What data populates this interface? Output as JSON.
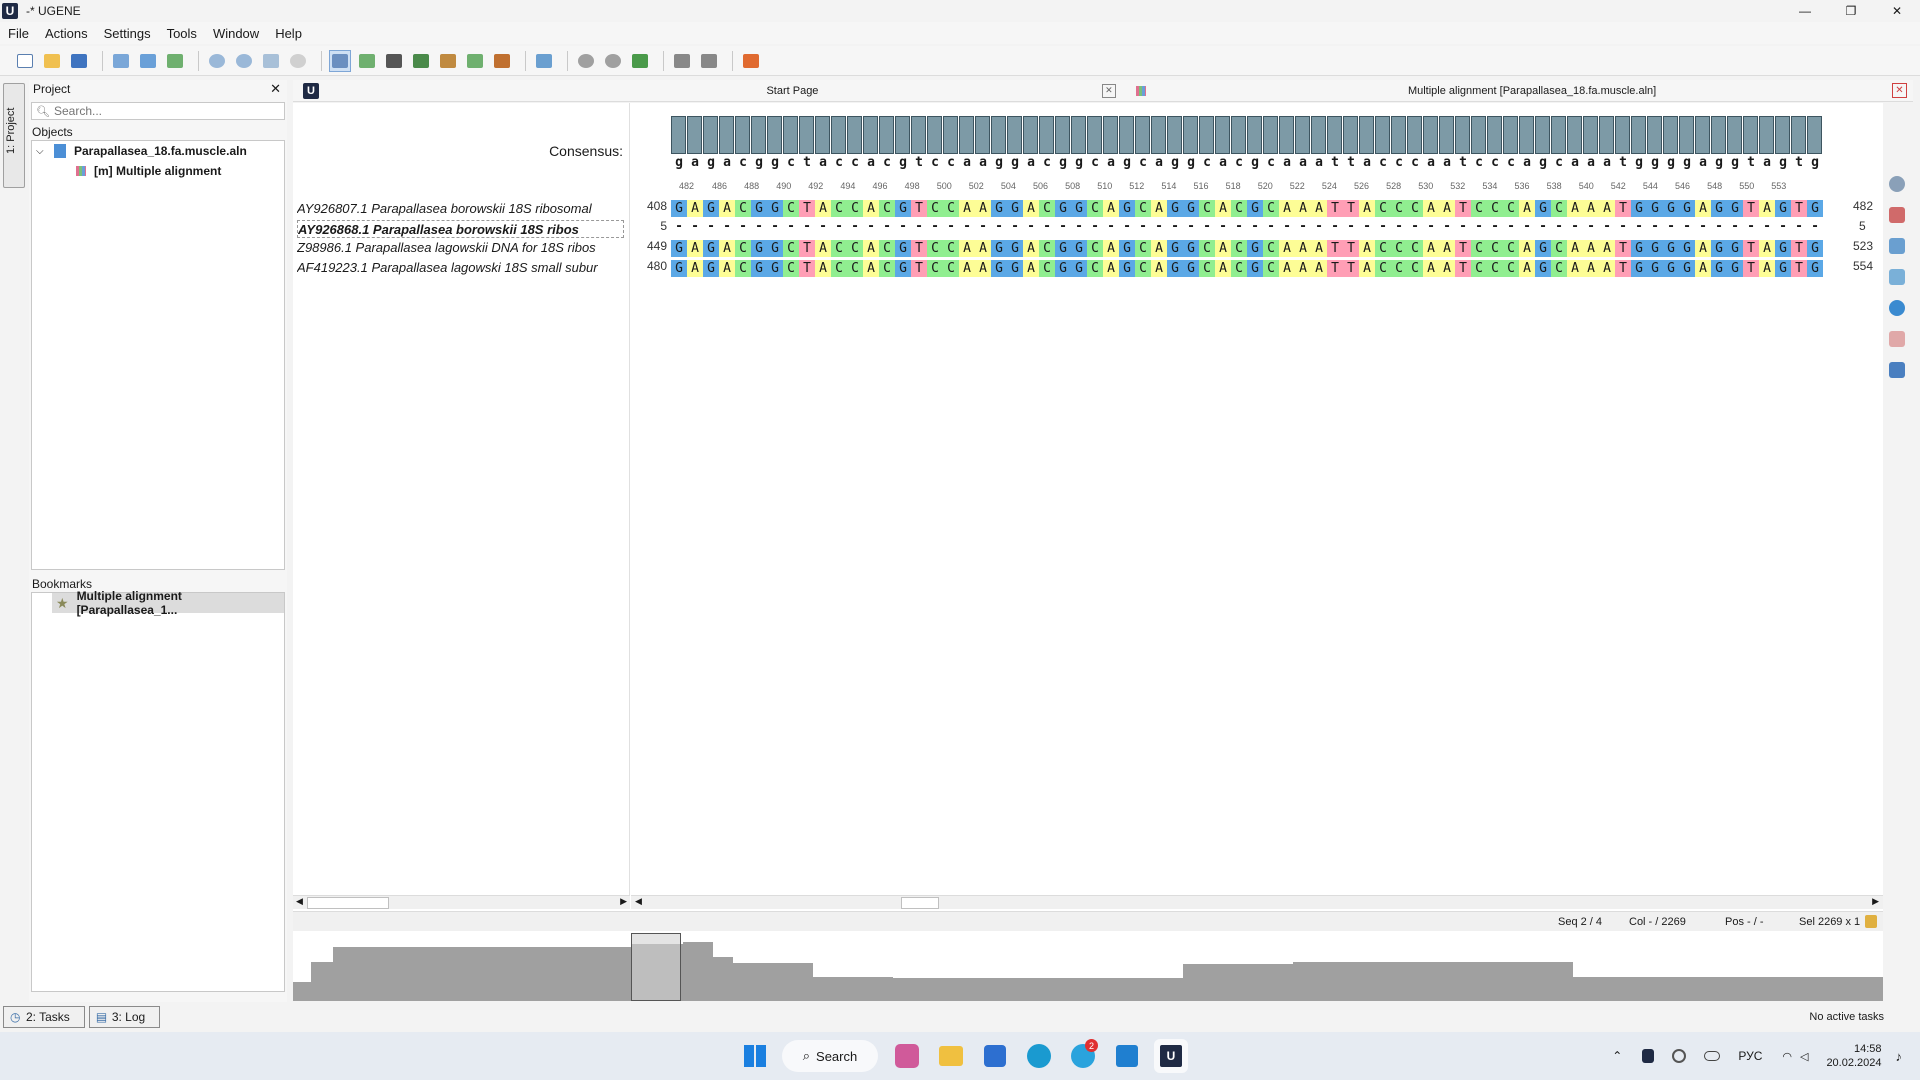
{
  "window": {
    "title": "-* UGENE",
    "app_icon_letter": "U"
  },
  "menu": [
    "File",
    "Actions",
    "Settings",
    "Tools",
    "Window",
    "Help"
  ],
  "side_tab_label": "1: Project",
  "project": {
    "header": "Project",
    "search_placeholder": "Search...",
    "objects_label": "Objects",
    "file_item": "Parapallasea_18.fa.muscle.aln",
    "alignment_item": "[m] Multiple alignment",
    "bookmarks_label": "Bookmarks",
    "bookmark_item": "Multiple alignment [Parapallasea_1..."
  },
  "bottom_tabs": [
    "2: Tasks",
    "3: Log"
  ],
  "no_tasks": "No active tasks",
  "tabs": {
    "start_page": "Start Page",
    "alignment_tab": "Multiple alignment [Parapallasea_18.fa.muscle.aln]",
    "editor_logo": "U"
  },
  "editor": {
    "consensus_label": "Consensus:",
    "consensus_seq": "gagacggctaccacgtccaaggacggcagcaggcacgcaaattacccaatcccagcaaatggggaggtagtg",
    "ruler": [
      "482",
      "486",
      "488",
      "490",
      "492",
      "494",
      "496",
      "498",
      "500",
      "502",
      "504",
      "506",
      "508",
      "510",
      "512",
      "514",
      "516",
      "518",
      "520",
      "522",
      "524",
      "526",
      "528",
      "530",
      "532",
      "534",
      "536",
      "538",
      "540",
      "542",
      "544",
      "546",
      "548",
      "550",
      "553"
    ],
    "sequences": [
      {
        "name": "AY926807.1 Parapallasea borowskii 18S ribosomal",
        "left": "408",
        "right": "482",
        "seq": "GAGACGGCTACCACGTCCAAGGACGGCAGCAGGCACGCAAATTACCCAATCCCAGCAAATGGGGAGGTAGTG"
      },
      {
        "name": "AY926868.1 Parapallasea borowskii 18S ribos",
        "left": "5",
        "right": "5",
        "seq": "------------------------------------------------------------------------"
      },
      {
        "name": "Z98986.1 Parapallasea lagowskii DNA for 18S ribos",
        "left": "449",
        "right": "523",
        "seq": "GAGACGGCTACCACGTCCAAGGACGGCAGCAGGCACGCAAATTACCCAATCCCAGCAAATGGGGAGGTAGTG"
      },
      {
        "name": "AF419223.1 Parapallasea lagowski 18S small subur",
        "left": "480",
        "right": "554",
        "seq": "GAGACGGCTACCACGTCCAAGGACGGCAGCAGGCACGCAAATTACCCAATCCCAGCAAATGGGGAGGTAGTG"
      }
    ],
    "nucleotide_colors": {
      "A": "#fdfd96",
      "C": "#90ee90",
      "G": "#5ba8e6",
      "T": "#ff9eb5"
    }
  },
  "status": {
    "seq": "Seq 2 / 4",
    "col": "Col - / 2269",
    "pos": "Pos - / -",
    "sel": "Sel 2269 x 1"
  },
  "taskbar": {
    "search_label": "Search",
    "tray_lang": "РУС",
    "time": "14:58",
    "date": "20.02.2024",
    "telegram_badge": "2"
  }
}
